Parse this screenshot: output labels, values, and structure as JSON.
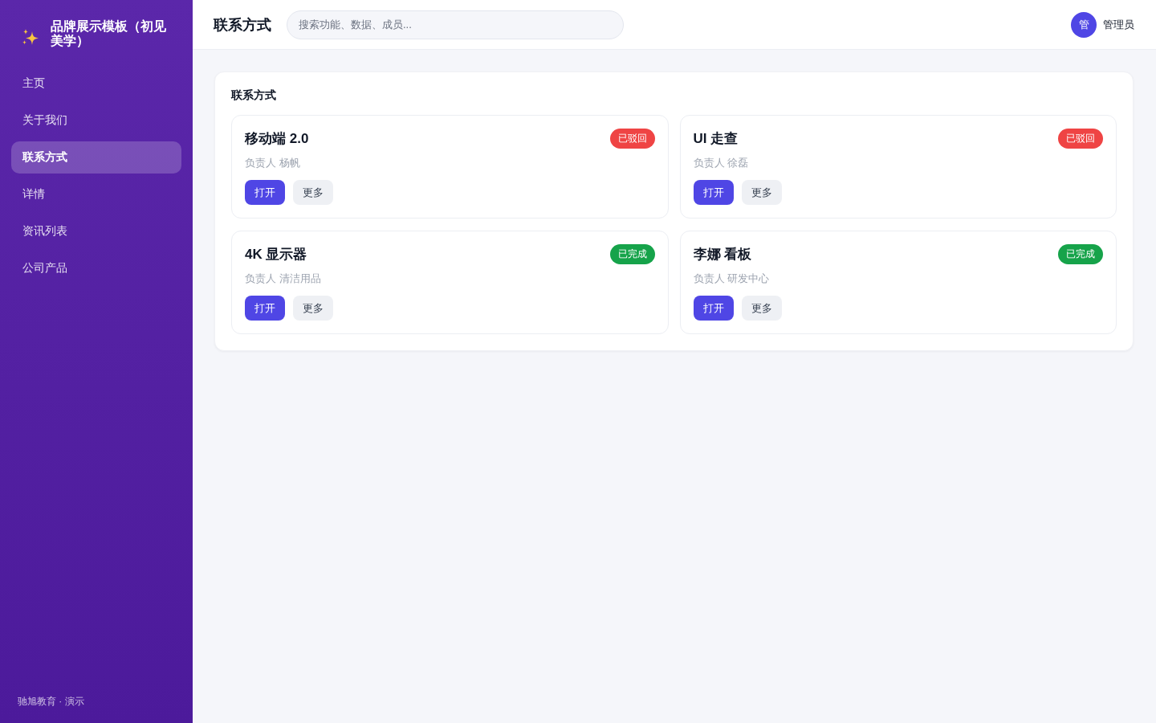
{
  "sidebar": {
    "brand": {
      "title": "品牌展示模板（初见美学）"
    },
    "items": [
      {
        "label": "主页",
        "selected": false
      },
      {
        "label": "关于我们",
        "selected": false
      },
      {
        "label": "联系方式",
        "selected": true
      },
      {
        "label": "详情",
        "selected": false
      },
      {
        "label": "资讯列表",
        "selected": false
      },
      {
        "label": "公司产品",
        "selected": false
      }
    ],
    "footer": "驰旭教育 · 演示"
  },
  "header": {
    "title": "联系方式",
    "search": {
      "placeholder": "搜索功能、数据、成员..."
    },
    "user": {
      "avatar": "管",
      "name": "管理员"
    }
  },
  "panel": {
    "title": "联系方式",
    "cards": [
      {
        "title": "移动端 2.0",
        "status": {
          "label": "已驳回",
          "color": "#ef4444"
        },
        "owner": "负责人 杨帆",
        "actions": [
          {
            "label": "打开",
            "kind": "primary"
          },
          {
            "label": "更多",
            "kind": "secondary"
          }
        ]
      },
      {
        "title": "UI 走查",
        "status": {
          "label": "已驳回",
          "color": "#ef4444"
        },
        "owner": "负责人 徐磊",
        "actions": [
          {
            "label": "打开",
            "kind": "primary"
          },
          {
            "label": "更多",
            "kind": "secondary"
          }
        ]
      },
      {
        "title": "4K 显示器",
        "status": {
          "label": "已完成",
          "color": "#16a34a"
        },
        "owner": "负责人 清洁用品",
        "actions": [
          {
            "label": "打开",
            "kind": "primary"
          },
          {
            "label": "更多",
            "kind": "secondary"
          }
        ]
      },
      {
        "title": "李娜 看板",
        "status": {
          "label": "已完成",
          "color": "#16a34a"
        },
        "owner": "负责人 研发中心",
        "actions": [
          {
            "label": "打开",
            "kind": "primary"
          },
          {
            "label": "更多",
            "kind": "secondary"
          }
        ]
      }
    ]
  }
}
